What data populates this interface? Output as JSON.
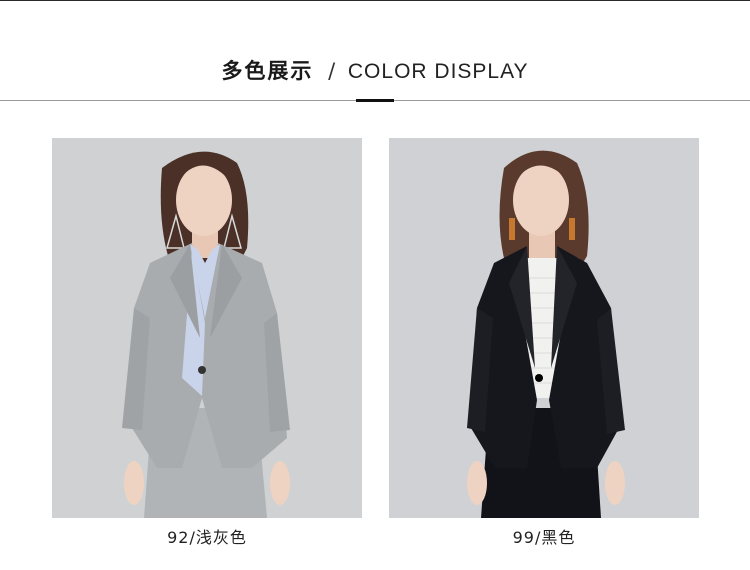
{
  "header": {
    "title_cn": "多色展示",
    "separator": "/",
    "title_en": "COLOR DISPLAY"
  },
  "products": [
    {
      "caption": "92/浅灰色",
      "image": "model-light-gray-blazer",
      "jacket_color": "#a9acae",
      "shirt_color": "#c9d4ea"
    },
    {
      "caption": "99/黑色",
      "image": "model-black-blazer",
      "jacket_color": "#15171c",
      "shirt_color": "#f1f1ef"
    }
  ]
}
